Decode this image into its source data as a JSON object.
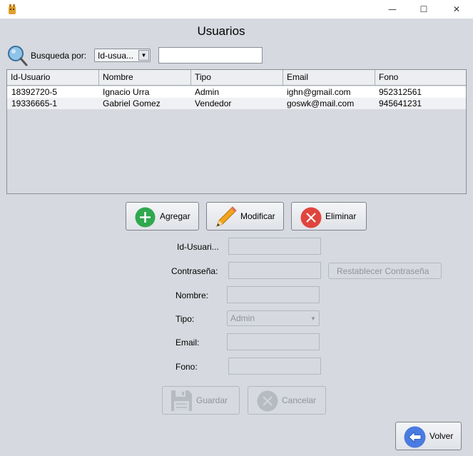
{
  "window": {
    "minimize": "—",
    "maximize": "☐",
    "close": "✕"
  },
  "title": "Usuarios",
  "search": {
    "label": "Busqueda por:",
    "selected": "Id-usua...",
    "value": ""
  },
  "table": {
    "columns": [
      "Id-Usuario",
      "Nombre",
      "Tipo",
      "Email",
      "Fono"
    ],
    "rows": [
      [
        "18392720-5",
        "Ignacio Urra",
        "Admin",
        "ighn@gmail.com",
        "952312561"
      ],
      [
        "19336665-1",
        "Gabriel Gomez",
        "Vendedor",
        "goswk@mail.com",
        "945641231"
      ]
    ]
  },
  "actions": {
    "add": "Agregar",
    "edit": "Modificar",
    "delete": "Eliminar"
  },
  "form": {
    "id_label": "Id-Usuari...",
    "password_label": "Contraseña:",
    "reset_password": "Restablecer Contraseña",
    "name_label": "Nombre:",
    "type_label": "Tipo:",
    "type_value": "Admin",
    "email_label": "Email:",
    "phone_label": "Fono:"
  },
  "form_actions": {
    "save": "Guardar",
    "cancel": "Cancelar"
  },
  "back": "Volver",
  "colors": {
    "add": "#2fa84f",
    "delete": "#e0453d",
    "back": "#4a7be0"
  }
}
